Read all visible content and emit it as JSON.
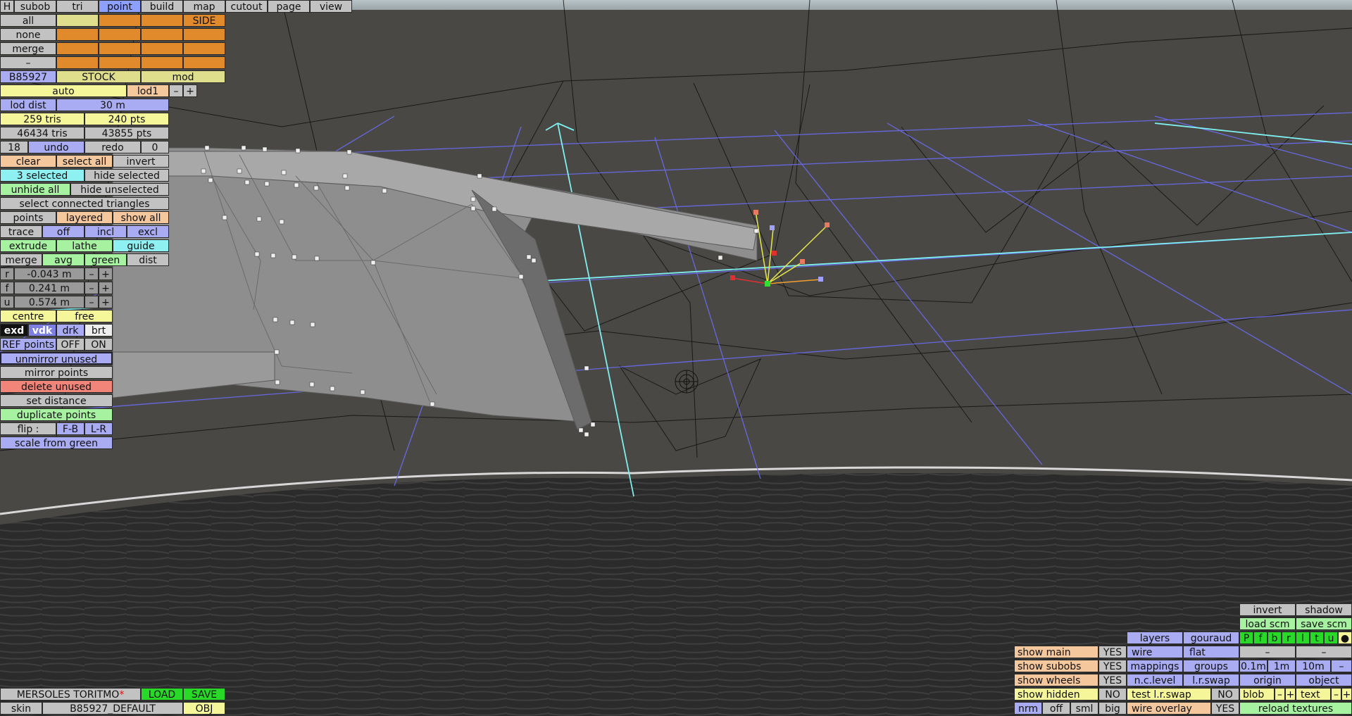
{
  "top_tabs": [
    "H",
    "subob",
    "tri",
    "point",
    "build",
    "map",
    "cutout",
    "page",
    "view"
  ],
  "top_tabs_active": "point",
  "sel_rows": {
    "all": "all",
    "none": "none",
    "merge": "merge",
    "minus": "–",
    "side": "SIDE"
  },
  "model_row": {
    "id": "B85927",
    "stock": "STOCK",
    "mod": "mod"
  },
  "lod_row": {
    "auto": "auto",
    "lod": "lod1",
    "minus": "–",
    "plus": "+"
  },
  "left_panel": {
    "lod_dist_label": "lod dist",
    "lod_dist_value": "30 m",
    "tris_sel": "259 tris",
    "pts_sel": "240 pts",
    "tris_total": "46434 tris",
    "pts_total": "43855 pts",
    "undo_count": "18",
    "undo": "undo",
    "redo": "redo",
    "redo_count": "0",
    "clear": "clear",
    "select_all": "select all",
    "invert": "invert",
    "selected": "3 selected",
    "hide_selected": "hide selected",
    "unhide_all": "unhide all",
    "hide_unselected": "hide unselected",
    "select_connected": "select connected triangles",
    "points": "points",
    "layered": "layered",
    "show_all": "show all",
    "trace": "trace",
    "off": "off",
    "incl": "incl",
    "excl": "excl",
    "extrude": "extrude",
    "lathe": "lathe",
    "guide": "guide",
    "merge": "merge",
    "avg": "avg",
    "green": "green",
    "dist": "dist",
    "r_label": "r",
    "r_value": "-0.043 m",
    "f_label": "f",
    "f_value": "0.241 m",
    "u_label": "u",
    "u_value": "0.574 m",
    "minus": "–",
    "plus": "+",
    "centre": "centre",
    "free": "free",
    "exd": "exd",
    "vdk": "vdk",
    "drk": "drk",
    "brt": "brt",
    "ref_points": "REF points",
    "ref_off": "OFF",
    "ref_on": "ON",
    "unmirror_unused": "unmirror unused",
    "mirror_points": "mirror points",
    "delete_unused": "delete unused",
    "set_distance": "set distance",
    "duplicate_points": "duplicate points",
    "flip": "flip :",
    "flip_fb": "F-B",
    "flip_lr": "L-R",
    "scale_from_green": "scale from green"
  },
  "bottom_left": {
    "car_name": "MERSOLES TORITMO",
    "asterisk": "*",
    "load": "LOAD",
    "save": "SAVE",
    "skin": "skin",
    "skin_value": "B85927_DEFAULT",
    "obj": "OBJ"
  },
  "bottom_right": {
    "show_main": "show main",
    "show_main_v": "YES",
    "show_subobs": "show subobs",
    "show_subobs_v": "YES",
    "show_wheels": "show wheels",
    "show_wheels_v": "YES",
    "show_hidden": "show hidden",
    "show_hidden_v": "NO",
    "nrm": "nrm",
    "off": "off",
    "sml": "sml",
    "big": "big",
    "layers": "layers",
    "gouraud": "gouraud",
    "wire": "wire",
    "flat": "flat",
    "mappings": "mappings",
    "groups": "groups",
    "nc_level": "n.c.level",
    "lr_swap": "l.r.swap",
    "test_lr_swap": "test l.r.swap",
    "test_lr_swap_v": "NO",
    "wire_overlay": "wire overlay",
    "wire_overlay_v": "YES",
    "invert": "invert",
    "shadow": "shadow",
    "load_scm": "load scm",
    "save_scm": "save scm",
    "flags": [
      "P",
      "f",
      "b",
      "r",
      "l",
      "t",
      "u",
      "●"
    ],
    "minus": "–",
    "plus": "+",
    "step_01": "0.1m",
    "step_1": "1m",
    "step_10": "10m",
    "origin": "origin",
    "object": "object",
    "blob": "blob",
    "text": "text",
    "reload_textures": "reload textures"
  },
  "colors": {
    "background": "#4a4845",
    "grid_blue": "#6a6cf0",
    "axis_cyan": "#7ff0f0",
    "mesh": "#8c8c8c"
  }
}
